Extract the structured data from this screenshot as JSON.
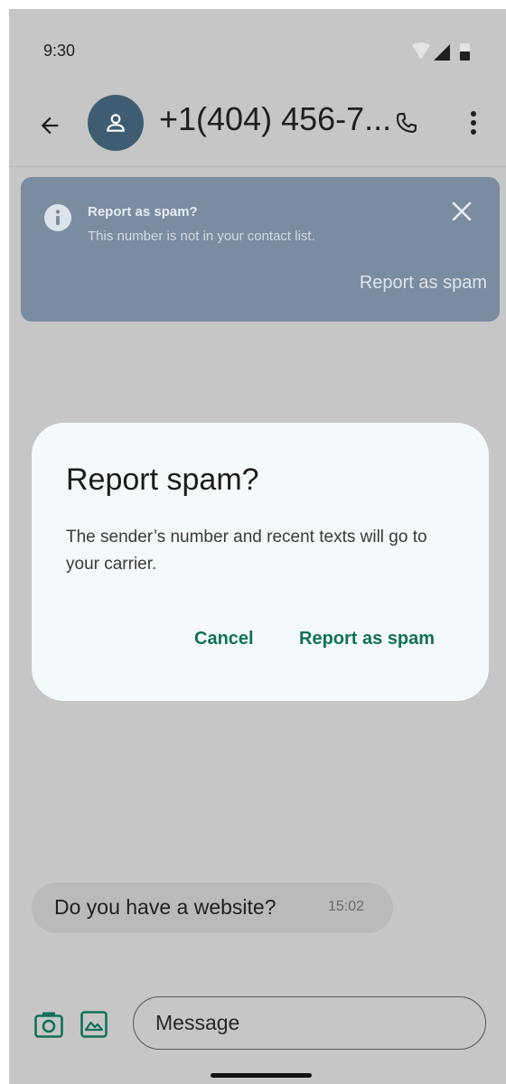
{
  "status_bar": {
    "time": "9:30",
    "icons": [
      "wifi-icon",
      "signal-icon",
      "battery-icon"
    ]
  },
  "app_bar": {
    "back_icon": "arrow-back-icon",
    "avatar_icon": "person-icon",
    "title": "+1(404) 456-7...",
    "call_icon": "phone-icon",
    "more_icon": "more-vert-icon"
  },
  "spam_banner": {
    "icon": "info-icon",
    "title": "Report as spam?",
    "subtitle": "This number is not in your contact list.",
    "close_icon": "close-icon",
    "action_label": "Report as spam"
  },
  "dialog": {
    "title": "Report spam?",
    "body": "The sender’s number and recent texts will go to your carrier.",
    "cancel_label": "Cancel",
    "confirm_label": "Report as spam"
  },
  "conversation": {
    "messages": [
      {
        "text": "Do you have a website?",
        "time": "15:02"
      }
    ]
  },
  "composer": {
    "camera_icon": "camera-icon",
    "gallery_icon": "gallery-icon",
    "placeholder": "Message"
  },
  "colors": {
    "accent": "#12705a",
    "banner": "#7a8ca0",
    "avatar": "#3e5d72",
    "background": "#c6c6c6",
    "dialog": "#f4f9fb"
  }
}
